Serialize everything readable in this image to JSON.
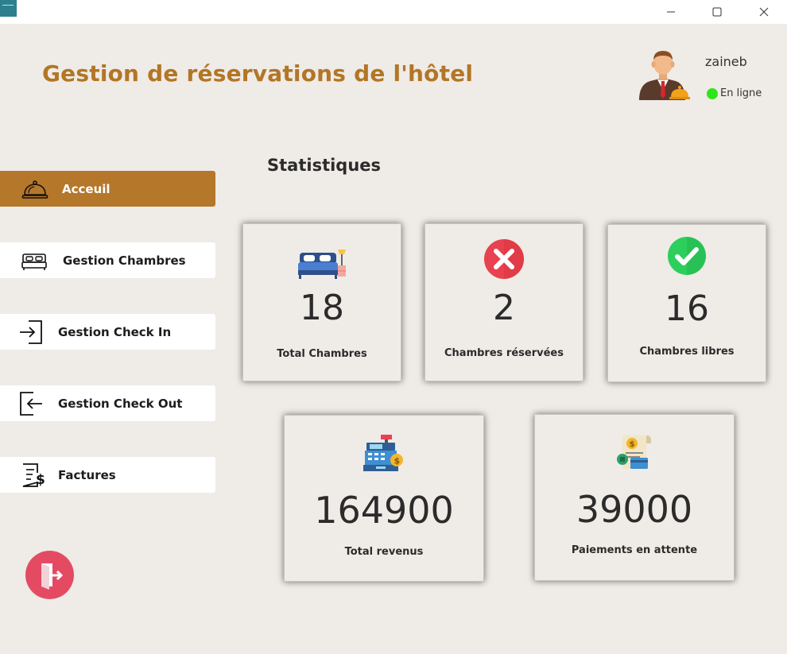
{
  "app": {
    "title": "Gestion de réservations de l'hôtel"
  },
  "user": {
    "name": "zaineb",
    "status": "En ligne",
    "status_color": "#2ee51a"
  },
  "colors": {
    "accent": "#b5772a",
    "background": "#efebe7",
    "logout": "#e44b63"
  },
  "sidebar": {
    "items": [
      {
        "label": "Acceuil",
        "icon": "service-bell-icon",
        "active": true
      },
      {
        "label": "Gestion Chambres",
        "icon": "bed-icon",
        "active": false
      },
      {
        "label": "Gestion Check In",
        "icon": "sign-in-icon",
        "active": false
      },
      {
        "label": "Gestion Check Out",
        "icon": "sign-out-icon",
        "active": false
      },
      {
        "label": "Factures",
        "icon": "invoice-dollar-icon",
        "active": false
      }
    ],
    "logout_icon": "exit-door-icon"
  },
  "main": {
    "section_title": "Statistiques",
    "cards": [
      {
        "value": "18",
        "label": "Total Chambres",
        "icon": "bed-room-icon"
      },
      {
        "value": "2",
        "label": "Chambres réservées",
        "icon": "red-x-circle-icon"
      },
      {
        "value": "16",
        "label": "Chambres libres",
        "icon": "green-check-circle-icon"
      },
      {
        "value": "164900",
        "label": "Total revenus",
        "icon": "cash-register-icon"
      },
      {
        "value": "39000",
        "label": "Paiements en attente",
        "icon": "bill-payment-icon"
      }
    ]
  }
}
